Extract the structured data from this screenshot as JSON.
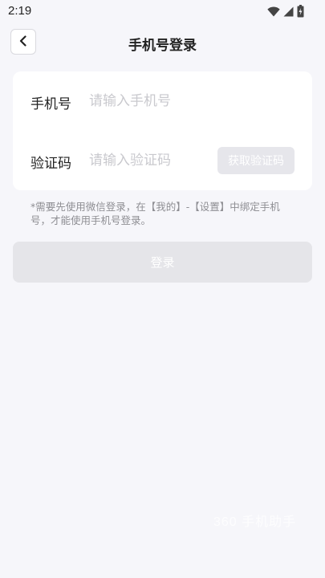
{
  "status_bar": {
    "time": "2:19",
    "icons": [
      "wifi-icon",
      "signal-icon",
      "battery-icon"
    ]
  },
  "header": {
    "title": "手机号登录",
    "back_icon": "chevron-left-icon"
  },
  "form": {
    "phone": {
      "label": "手机号",
      "placeholder": "请输入手机号",
      "value": ""
    },
    "code": {
      "label": "验证码",
      "placeholder": "请输入验证码",
      "value": "",
      "button_label": "获取验证码"
    }
  },
  "notice": "*需要先使用微信登录，在【我的】-【设置】中绑定手机号，才能使用手机号登录。",
  "login_button_label": "登录",
  "watermark": "360 手机助手",
  "colors": {
    "background": "#f6f6fa",
    "card": "#ffffff",
    "disabled_button": "#e5e5e9",
    "placeholder": "#c9c9ce",
    "notice": "#8e8e93"
  }
}
